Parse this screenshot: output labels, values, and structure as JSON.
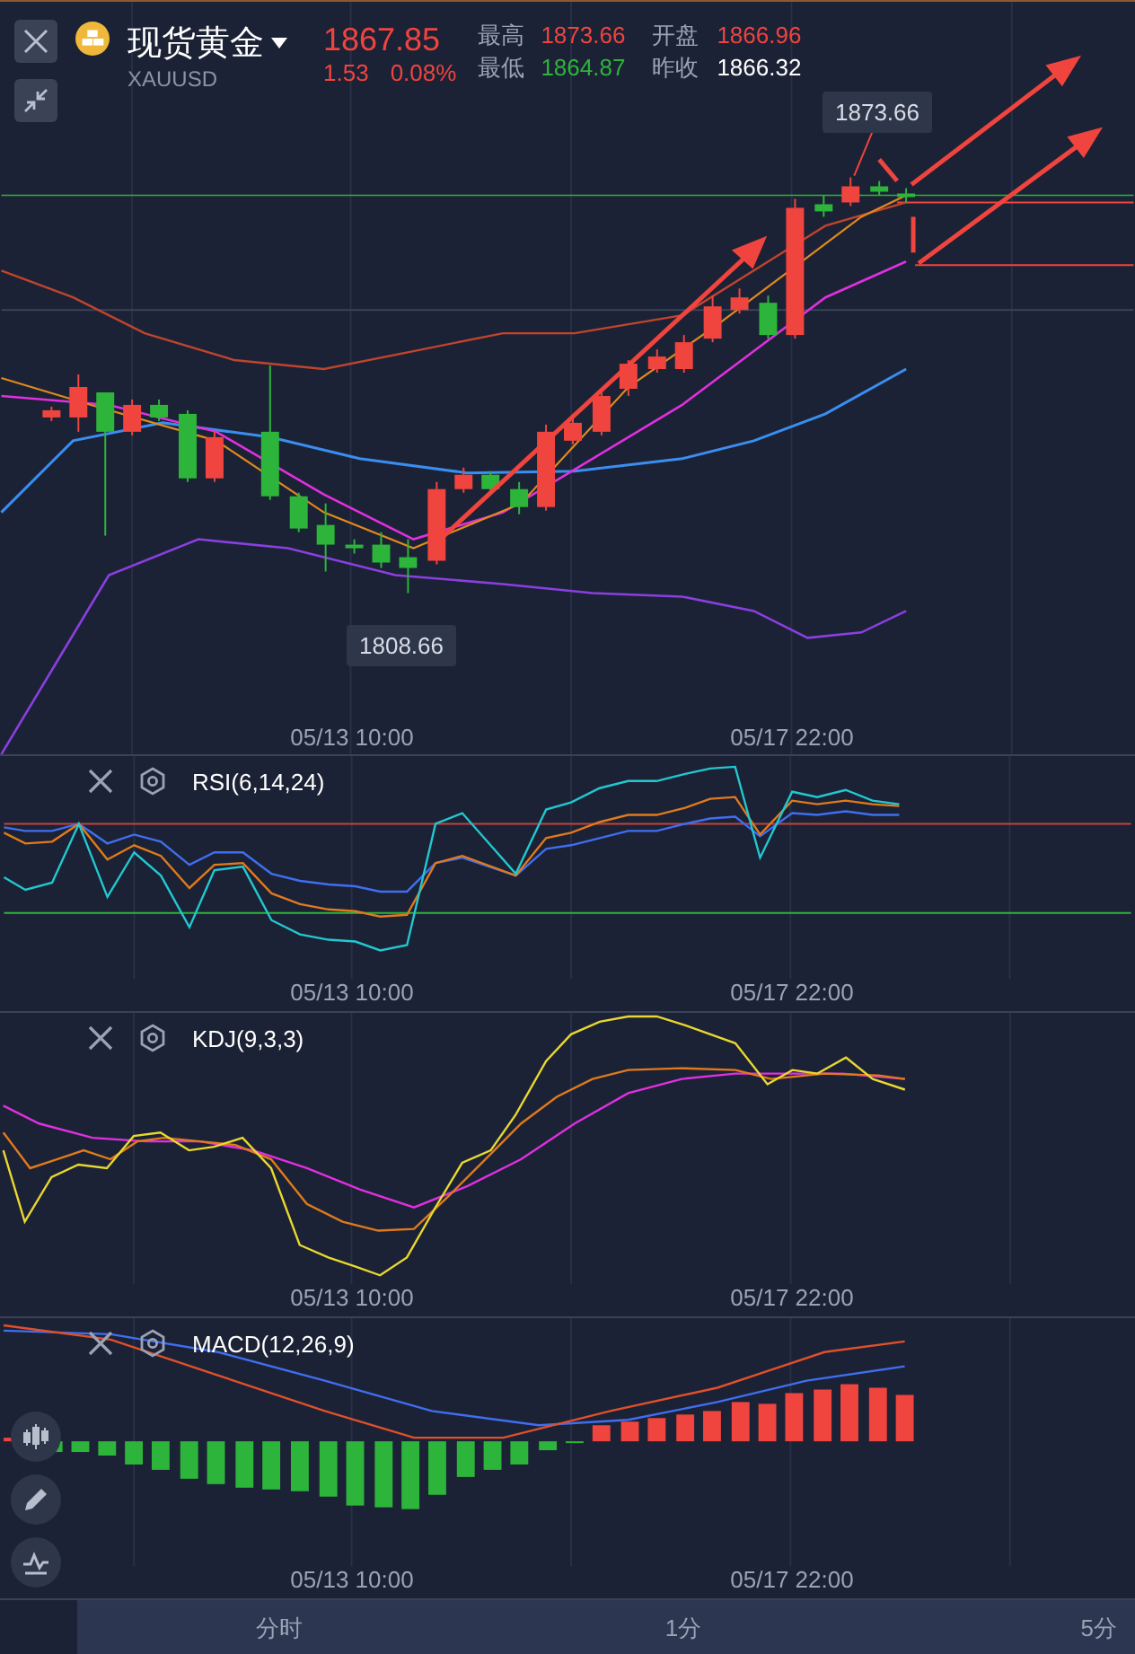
{
  "header": {
    "name": "现货黄金",
    "symbol": "XAUUSD",
    "price": "1867.85",
    "change": "1.53",
    "change_pct": "0.08%",
    "stats": [
      {
        "label": "最高",
        "value": "1873.66",
        "kind": "up"
      },
      {
        "label": "开盘",
        "value": "1866.96",
        "kind": "up"
      },
      {
        "label": "最低",
        "value": "1864.87",
        "kind": "down"
      },
      {
        "label": "昨收",
        "value": "1866.32",
        "kind": "flat"
      }
    ]
  },
  "price_chart": {
    "high_label": "1873.66",
    "low_label": "1808.66",
    "x_labels": [
      "05/13 10:00",
      "05/17 22:00"
    ]
  },
  "indicators": [
    {
      "kind": "rsi",
      "title": "RSI(6,14,24)",
      "x_labels": [
        "05/13 10:00",
        "05/17 22:00"
      ]
    },
    {
      "kind": "kdj",
      "title": "KDJ(9,3,3)",
      "x_labels": [
        "05/13 10:00",
        "05/17 22:00"
      ]
    },
    {
      "kind": "macd",
      "title": "MACD(12,26,9)",
      "x_labels": [
        "05/13 10:00",
        "05/17 22:00"
      ]
    }
  ],
  "periods": [
    {
      "label": "分时",
      "selected": false
    },
    {
      "label": "1分",
      "selected": false
    },
    {
      "label": "5分",
      "selected": false
    }
  ]
}
